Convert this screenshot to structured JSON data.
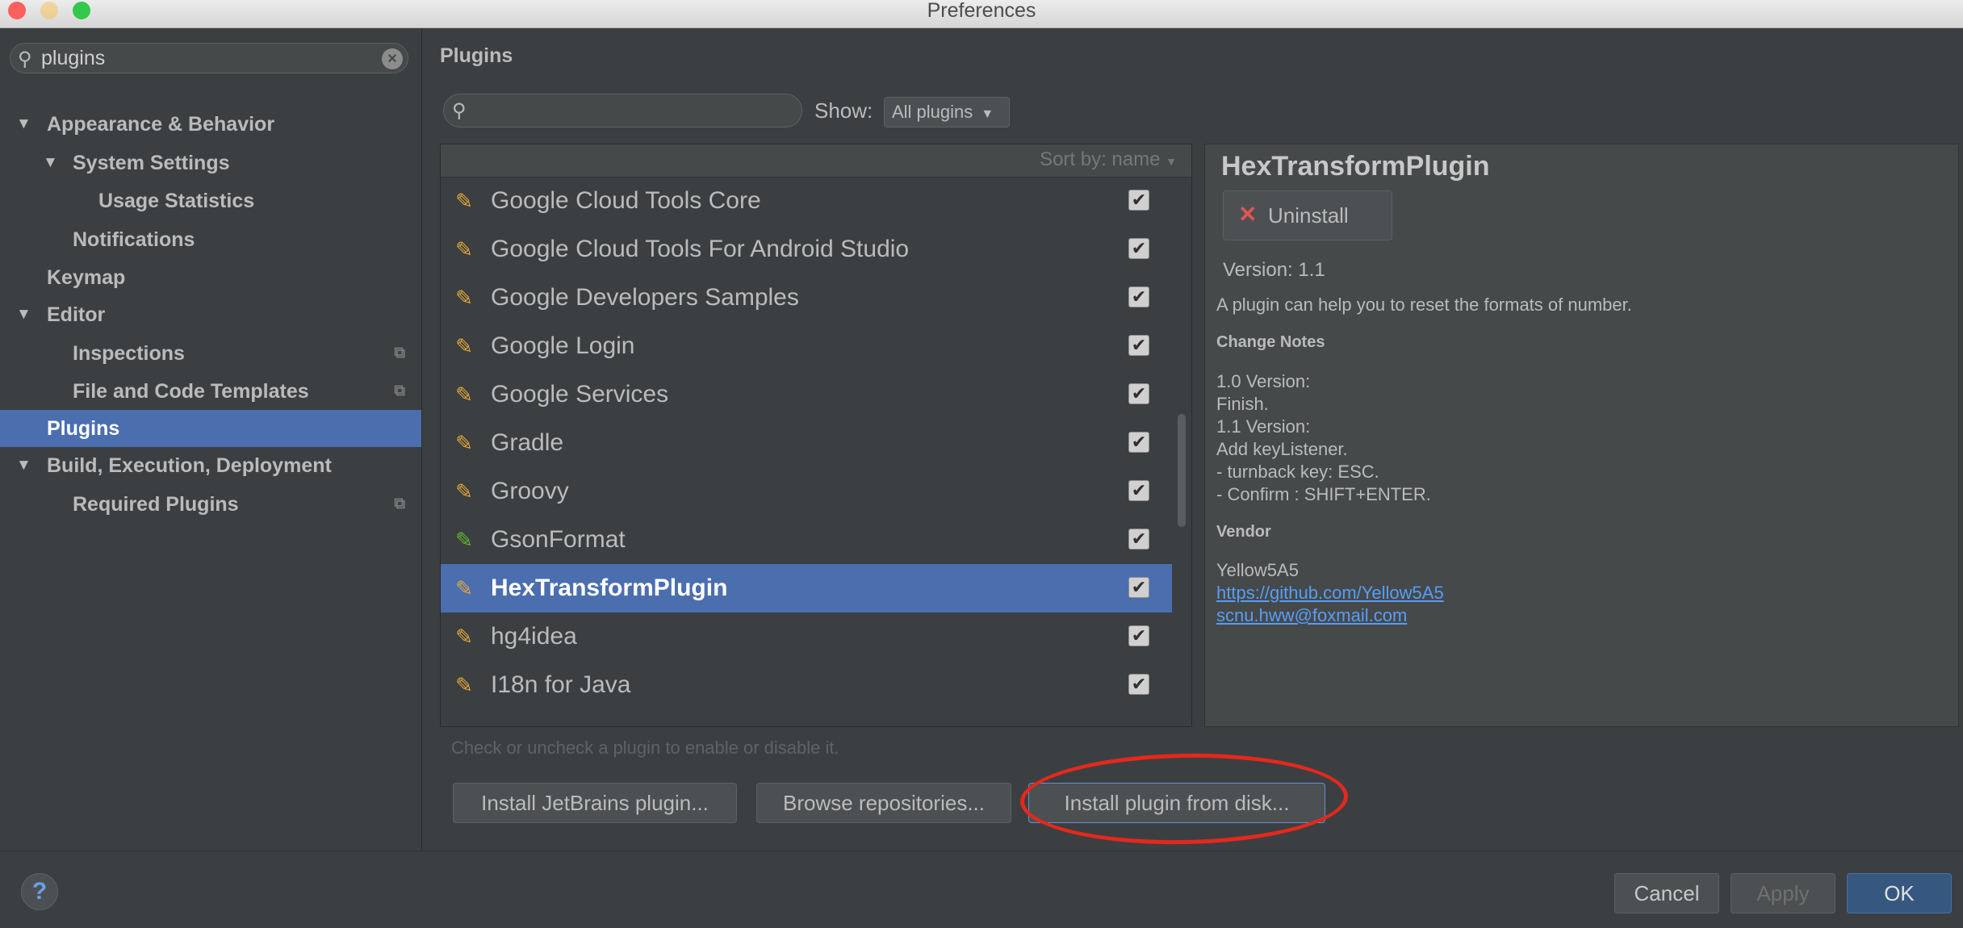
{
  "window": {
    "title": "Preferences",
    "traffic_lights": {
      "close": "#fc605c",
      "minimize": "#fdbc40",
      "maximize": "#34c84a"
    }
  },
  "sidebar": {
    "search_value": "plugins",
    "items": [
      {
        "label": "Appearance & Behavior",
        "arrow": "▼"
      },
      {
        "label": "System Settings",
        "arrow": "▼"
      },
      {
        "label": "Usage Statistics"
      },
      {
        "label": "Notifications"
      },
      {
        "label": "Keymap"
      },
      {
        "label": "Editor",
        "arrow": "▼"
      },
      {
        "label": "Inspections"
      },
      {
        "label": "File and Code Templates"
      },
      {
        "label": "Plugins"
      },
      {
        "label": "Build, Execution, Deployment",
        "arrow": "▼"
      },
      {
        "label": "Required Plugins"
      }
    ]
  },
  "main": {
    "title": "Plugins",
    "search_placeholder": "",
    "show_label": "Show:",
    "show_value": "All plugins",
    "sort_label": "Sort by: name",
    "plugins": [
      {
        "name": "Google Cloud Tools Core",
        "enabled": true
      },
      {
        "name": "Google Cloud Tools For Android Studio",
        "enabled": true
      },
      {
        "name": "Google Developers Samples",
        "enabled": true
      },
      {
        "name": "Google Login",
        "enabled": true
      },
      {
        "name": "Google Services",
        "enabled": true
      },
      {
        "name": "Gradle",
        "enabled": true
      },
      {
        "name": "Groovy",
        "enabled": true
      },
      {
        "name": "GsonFormat",
        "enabled": true
      },
      {
        "name": "HexTransformPlugin",
        "enabled": true,
        "selected": true
      },
      {
        "name": "hg4idea",
        "enabled": true
      },
      {
        "name": "I18n for Java",
        "enabled": true
      }
    ],
    "hint": "Check or uncheck a plugin to enable or disable it.",
    "buttons": {
      "install_jetbrains": "Install JetBrains plugin...",
      "browse": "Browse repositories...",
      "install_disk": "Install plugin from disk..."
    }
  },
  "details": {
    "title": "HexTransformPlugin",
    "uninstall_label": "Uninstall",
    "version": "Version: 1.1",
    "description": "A plugin can help you to reset the formats of number.",
    "change_notes_heading": "Change Notes",
    "change_notes": [
      "1.0 Version:",
      "Finish.",
      "1.1 Version:",
      "Add keyListener.",
      "- turnback key: ESC.",
      "- Confirm : SHIFT+ENTER."
    ],
    "vendor_heading": "Vendor",
    "vendor_name": "Yellow5A5",
    "vendor_url": "https://github.com/Yellow5A5",
    "vendor_email": "scnu.hww@foxmail.com"
  },
  "footer": {
    "help": "?",
    "cancel": "Cancel",
    "apply": "Apply",
    "ok": "OK"
  }
}
